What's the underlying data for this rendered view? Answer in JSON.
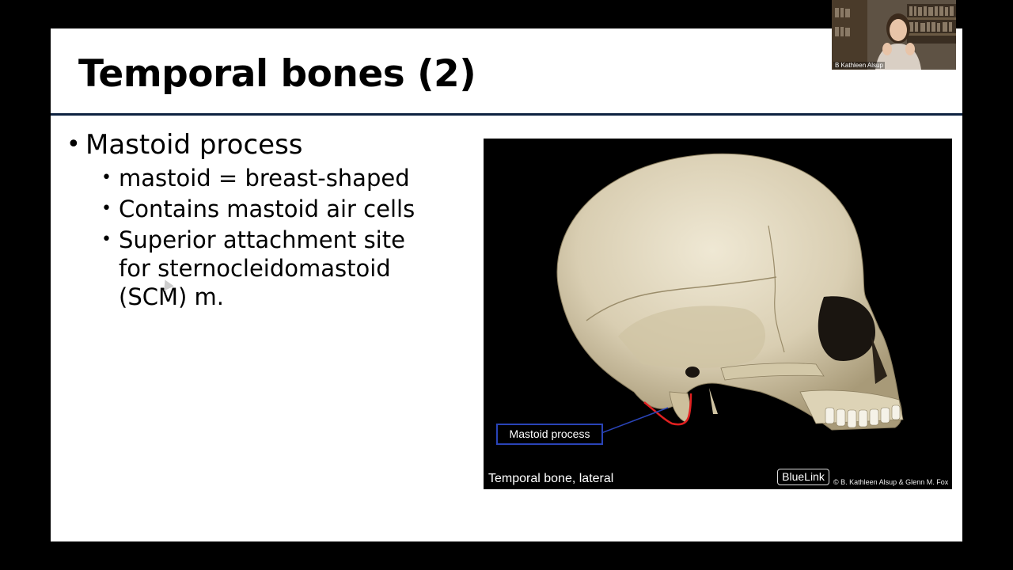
{
  "slide": {
    "title": "Temporal bones (2)",
    "bullets": [
      {
        "text": "Mastoid process",
        "sub": [
          "mastoid = breast-shaped",
          "Contains mastoid air cells",
          "Superior attachment site for sternocleidomastoid (SCM) m."
        ]
      }
    ],
    "bullet_char": "•"
  },
  "figure": {
    "caption": "Temporal bone, lateral",
    "callout_label": "Mastoid process",
    "logo": "BlueLink",
    "copyright": "© B. Kathleen Alsup & Glenn M. Fox"
  },
  "video": {
    "participant_name": "B Kathleen Alsup"
  },
  "colors": {
    "title_rule": "#0d2240",
    "callout_border": "#2a44b8",
    "outline_red": "#e02020"
  }
}
